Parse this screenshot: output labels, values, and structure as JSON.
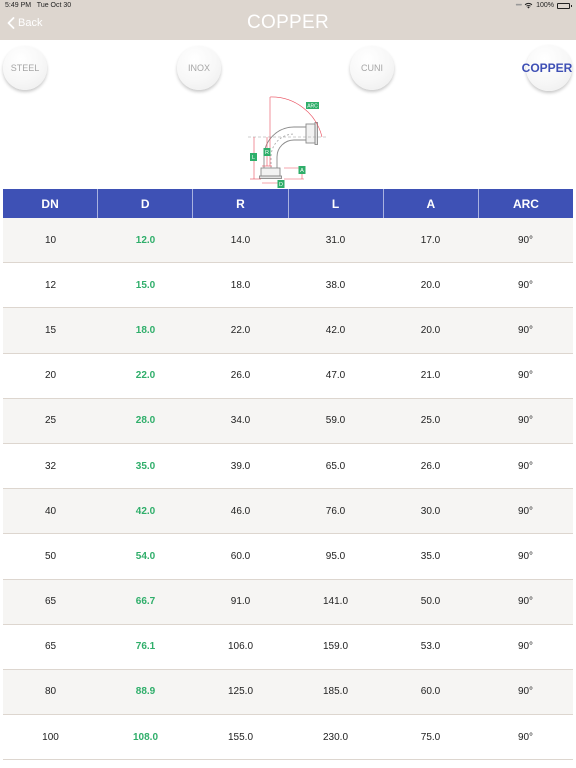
{
  "status_bar": {
    "time": "5:49 PM",
    "date": "Tue Oct 30",
    "battery": "100%"
  },
  "navbar": {
    "back_label": "Back",
    "title": "COPPER"
  },
  "materials": [
    {
      "label": "STEEL",
      "active": false
    },
    {
      "label": "INOX",
      "active": false
    },
    {
      "label": "CUNI",
      "active": false
    },
    {
      "label": "COPPER",
      "active": true
    }
  ],
  "diagram": {
    "labels": {
      "arc": "ARC",
      "l": "L",
      "r": "R",
      "a": "A",
      "d": "D"
    },
    "colors": {
      "dimension": "#e94b5b",
      "label_bg": "#2fae6a",
      "pipe": "#888888"
    }
  },
  "colors": {
    "navbar": "#ddd6cf",
    "header": "#3e51b5",
    "accent_active": "#3e4fb5",
    "d_value": "#2fae6a",
    "row_alt": "#f6f5f3"
  },
  "table": {
    "headers": [
      "DN",
      "D",
      "R",
      "L",
      "A",
      "ARC"
    ],
    "rows": [
      [
        "10",
        "12.0",
        "14.0",
        "31.0",
        "17.0",
        "90°"
      ],
      [
        "12",
        "15.0",
        "18.0",
        "38.0",
        "20.0",
        "90°"
      ],
      [
        "15",
        "18.0",
        "22.0",
        "42.0",
        "20.0",
        "90°"
      ],
      [
        "20",
        "22.0",
        "26.0",
        "47.0",
        "21.0",
        "90°"
      ],
      [
        "25",
        "28.0",
        "34.0",
        "59.0",
        "25.0",
        "90°"
      ],
      [
        "32",
        "35.0",
        "39.0",
        "65.0",
        "26.0",
        "90°"
      ],
      [
        "40",
        "42.0",
        "46.0",
        "76.0",
        "30.0",
        "90°"
      ],
      [
        "50",
        "54.0",
        "60.0",
        "95.0",
        "35.0",
        "90°"
      ],
      [
        "65",
        "66.7",
        "91.0",
        "141.0",
        "50.0",
        "90°"
      ],
      [
        "65",
        "76.1",
        "106.0",
        "159.0",
        "53.0",
        "90°"
      ],
      [
        "80",
        "88.9",
        "125.0",
        "185.0",
        "60.0",
        "90°"
      ],
      [
        "100",
        "108.0",
        "155.0",
        "230.0",
        "75.0",
        "90°"
      ]
    ]
  }
}
